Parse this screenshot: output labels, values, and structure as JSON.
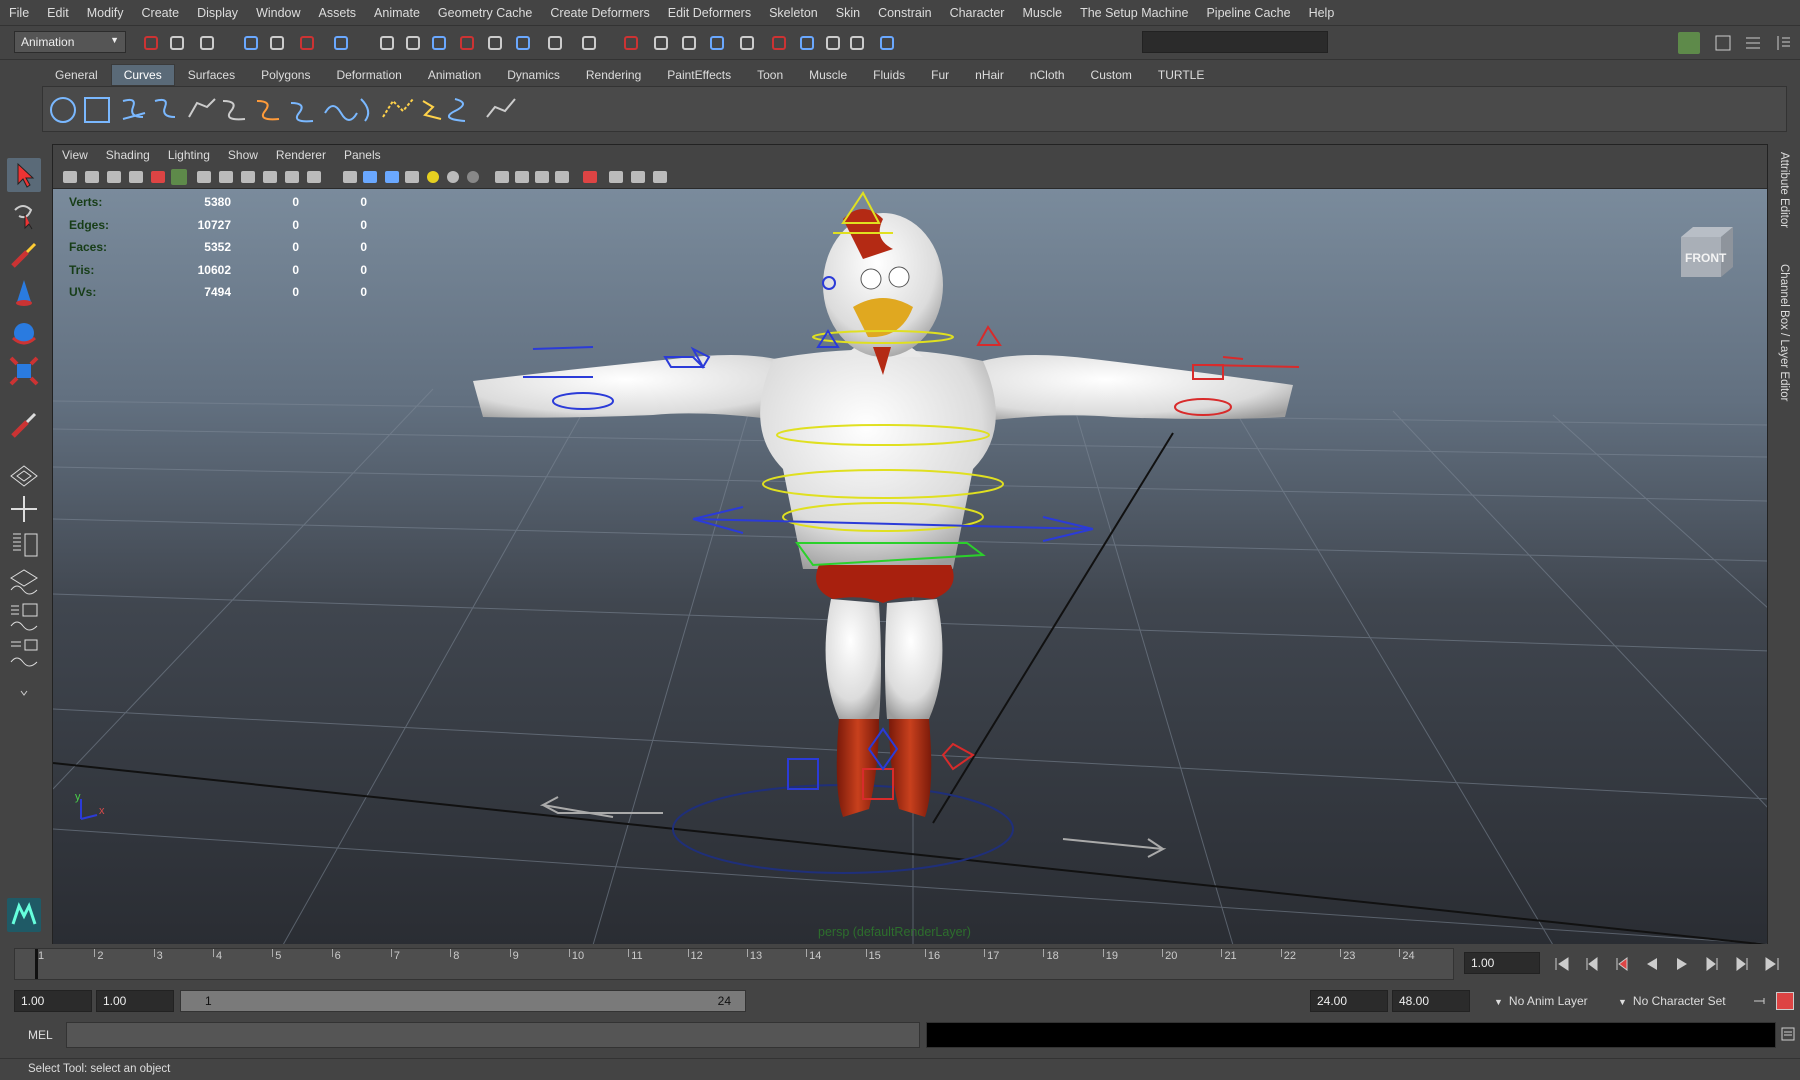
{
  "menubar": [
    "File",
    "Edit",
    "Modify",
    "Create",
    "Display",
    "Window",
    "Assets",
    "Animate",
    "Geometry Cache",
    "Create Deformers",
    "Edit Deformers",
    "Skeleton",
    "Skin",
    "Constrain",
    "Character",
    "Muscle",
    "The Setup Machine",
    "Pipeline Cache",
    "Help"
  ],
  "statusline": {
    "menuset": "Animation"
  },
  "shelf": {
    "tabs": [
      "General",
      "Curves",
      "Surfaces",
      "Polygons",
      "Deformation",
      "Animation",
      "Dynamics",
      "Rendering",
      "PaintEffects",
      "Toon",
      "Muscle",
      "Fluids",
      "Fur",
      "nHair",
      "nCloth",
      "Custom",
      "TURTLE"
    ],
    "active_tab": "Curves"
  },
  "viewport": {
    "menu": [
      "View",
      "Shading",
      "Lighting",
      "Show",
      "Renderer",
      "Panels"
    ],
    "hud": [
      {
        "label": "Verts:",
        "v1": "5380",
        "v2": "0",
        "v3": "0"
      },
      {
        "label": "Edges:",
        "v1": "10727",
        "v2": "0",
        "v3": "0"
      },
      {
        "label": "Faces:",
        "v1": "5352",
        "v2": "0",
        "v3": "0"
      },
      {
        "label": "Tris:",
        "v1": "10602",
        "v2": "0",
        "v3": "0"
      },
      {
        "label": "UVs:",
        "v1": "7494",
        "v2": "0",
        "v3": "0"
      }
    ],
    "camera_label": "persp (defaultRenderLayer)",
    "viewcube_label": "FRONT",
    "axis_y": "y",
    "axis_x": "x"
  },
  "side_tabs": {
    "attribute_editor": "Attribute Editor",
    "channel_box": "Channel Box / Layer Editor"
  },
  "timeslider": {
    "frames": [
      "1",
      "2",
      "3",
      "4",
      "5",
      "6",
      "7",
      "8",
      "9",
      "10",
      "11",
      "12",
      "13",
      "14",
      "15",
      "16",
      "17",
      "18",
      "19",
      "20",
      "21",
      "22",
      "23",
      "24"
    ],
    "current_frame": "1.00"
  },
  "rangeslider": {
    "start": "1.00",
    "playback_start": "1.00",
    "range_start": "1",
    "range_end": "24",
    "playback_end": "24.00",
    "end": "48.00",
    "anim_layer": "No Anim Layer",
    "character_set": "No Character Set"
  },
  "cmdline": {
    "label": "MEL"
  },
  "helpline": {
    "text": "Select Tool: select an object"
  },
  "colors": {
    "active_tab": "#5a6a78",
    "hud_label": "#173d17",
    "camera_label": "#2d6e2d"
  }
}
